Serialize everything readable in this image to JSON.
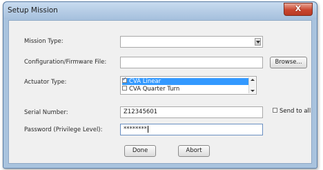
{
  "window": {
    "title": "Setup Mission",
    "close_glyph": "X"
  },
  "labels": {
    "mission_type": "Mission Type:",
    "config_file": "Configuration/Firmware File:",
    "actuator_type": "Actuator Type:",
    "serial_number": "Serial Number:",
    "password": "Password (Privilege Level):"
  },
  "fields": {
    "mission_type": {
      "value": ""
    },
    "config_file": {
      "value": ""
    },
    "serial_number": {
      "value": "Z12345601"
    },
    "password": {
      "value": "********"
    }
  },
  "actuator_list": [
    {
      "label": "CVA Linear",
      "checked": true,
      "selected": true
    },
    {
      "label": "CVA Quarter Turn",
      "checked": false,
      "selected": false
    }
  ],
  "send_to_all": {
    "label": "Send to all",
    "checked": false
  },
  "buttons": {
    "browse": "Browse...",
    "done": "Done",
    "abort": "Abort"
  },
  "colors": {
    "selection": "#3399ff",
    "close_button": "#c9462f",
    "frame": "#a9c3de"
  }
}
